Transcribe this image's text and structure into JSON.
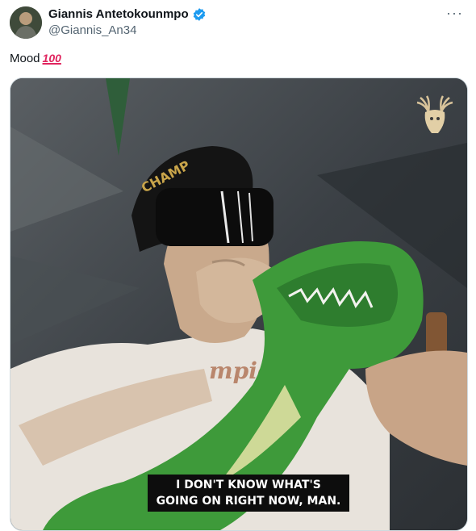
{
  "author": {
    "display_name": "Giannis Antetokounmpo",
    "handle": "@Giannis_An34",
    "verified": true,
    "verified_color": "#1d9bf0"
  },
  "more_label": "···",
  "tweet": {
    "text": "Mood",
    "emoji": "100"
  },
  "media": {
    "subtitle_line1": "I DON'T KNOW WHAT'S",
    "subtitle_line2": "GOING ON RIGHT NOW, MAN.",
    "cap_text": "CHAMP",
    "shirt_text": "mpio",
    "logo_icon": "deer-head-icon"
  }
}
